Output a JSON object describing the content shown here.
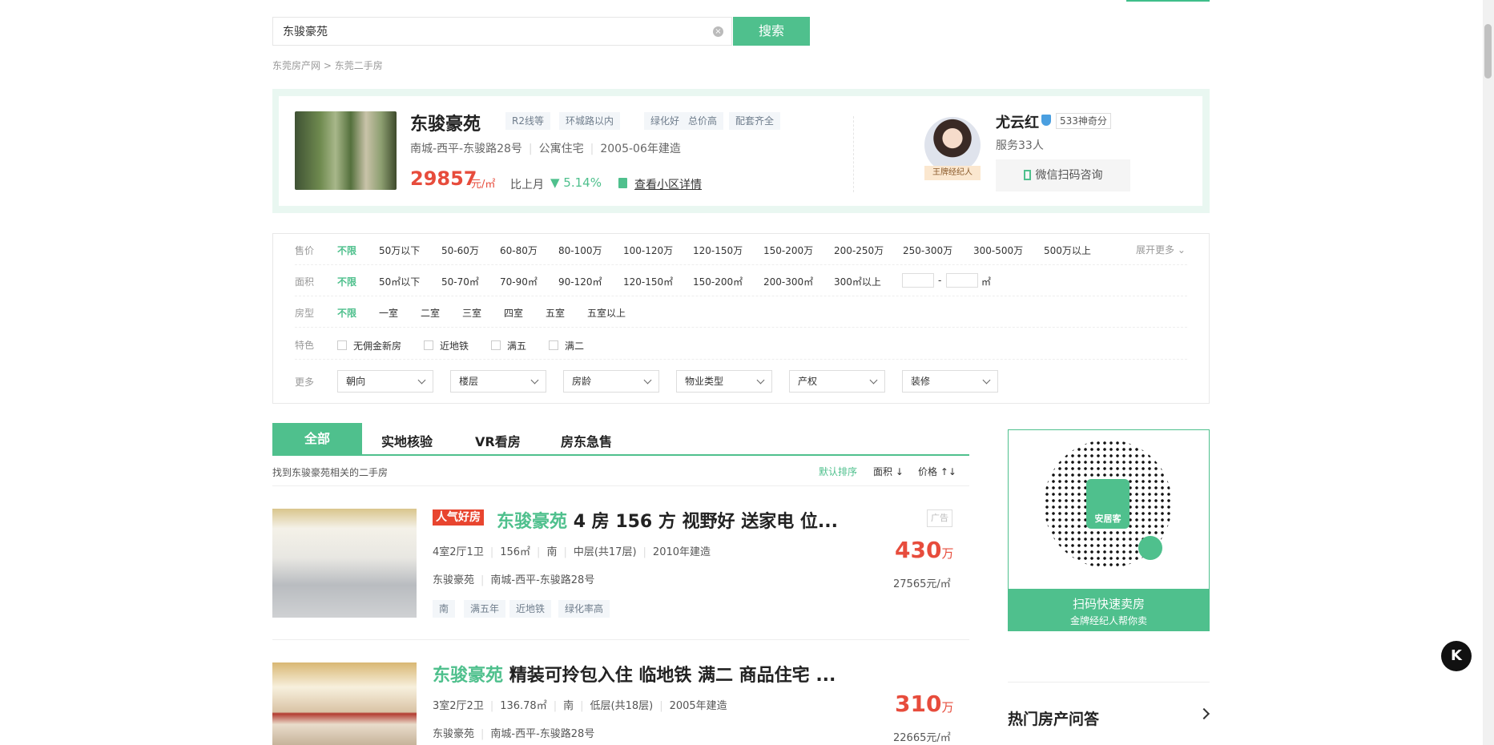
{
  "search": {
    "value": "东骏豪苑",
    "button": "搜索"
  },
  "breadcrumb": {
    "home": "东莞房产网",
    "sep": ">",
    "current": "东莞二手房"
  },
  "community": {
    "name": "东骏豪苑",
    "tags": [
      "R2线等",
      "环城路以内",
      "绿化好",
      "总价高",
      "配套齐全"
    ],
    "address": "南城-西平-东骏路28号",
    "type": "公寓住宅",
    "year": "2005-06年建造",
    "price": "29857",
    "price_unit": "元/㎡",
    "compare_label": "比上月",
    "trend": "▼ 5.14%",
    "detail_link": "查看小区详情"
  },
  "agent": {
    "badge": "王牌经纪人",
    "name": "尤云红",
    "score": "533神奇分",
    "served": "服务33人",
    "wechat_btn": "微信扫码咨询"
  },
  "filters": {
    "price": {
      "label": "售价",
      "options": [
        "不限",
        "50万以下",
        "50-60万",
        "60-80万",
        "80-100万",
        "100-120万",
        "120-150万",
        "150-200万",
        "200-250万",
        "250-300万",
        "300-500万",
        "500万以上"
      ],
      "expand": "展开更多"
    },
    "area": {
      "label": "面积",
      "options": [
        "不限",
        "50㎡以下",
        "50-70㎡",
        "70-90㎡",
        "90-120㎡",
        "120-150㎡",
        "150-200㎡",
        "200-300㎡",
        "300㎡以上"
      ],
      "range_sep": "-",
      "unit": "㎡"
    },
    "room": {
      "label": "房型",
      "options": [
        "不限",
        "一室",
        "二室",
        "三室",
        "四室",
        "五室",
        "五室以上"
      ]
    },
    "feature": {
      "label": "特色",
      "options": [
        "无佣金新房",
        "近地铁",
        "满五",
        "满二"
      ]
    },
    "more": {
      "label": "更多",
      "dropdowns": [
        "朝向",
        "楼层",
        "房龄",
        "物业类型",
        "产权",
        "装修"
      ]
    }
  },
  "tabs": [
    "全部",
    "实地核验",
    "VR看房",
    "房东急售"
  ],
  "list_header": {
    "found": "找到东骏豪苑相关的二手房",
    "sort_default": "默认排序",
    "sort_area": "面积",
    "sort_price": "价格"
  },
  "listings": [
    {
      "badge": "人气好房",
      "title_hl": "东骏豪苑",
      "title": "4 房 156 方 视野好 送家电 位...",
      "layout": "4室2厅1卫",
      "area": "156㎡",
      "orient": "南",
      "floor": "中层(共17层)",
      "year": "2010年建造",
      "community": "东骏豪苑",
      "address": "南城-西平-东骏路28号",
      "tags": [
        "南",
        "满五年",
        "近地铁",
        "绿化率高"
      ],
      "ad": "广告",
      "price": "430",
      "price_unit": "万",
      "unit_price": "27565元/㎡"
    },
    {
      "title_hl": "东骏豪苑",
      "title": "精装可拎包入住 临地铁 满二 商品住宅 ...",
      "layout": "3室2厅2卫",
      "area": "136.78㎡",
      "orient": "南",
      "floor": "低层(共18层)",
      "year": "2005年建造",
      "community": "东骏豪苑",
      "address": "南城-西平-东骏路28号",
      "price": "310",
      "price_unit": "万",
      "unit_price": "22665元/㎡"
    }
  ],
  "side": {
    "qr_logo": "安居客",
    "banner_title": "扫码快速卖房",
    "banner_sub": "金牌经纪人帮你卖",
    "hot_qa": "热门房产问答"
  },
  "float_button": "K"
}
